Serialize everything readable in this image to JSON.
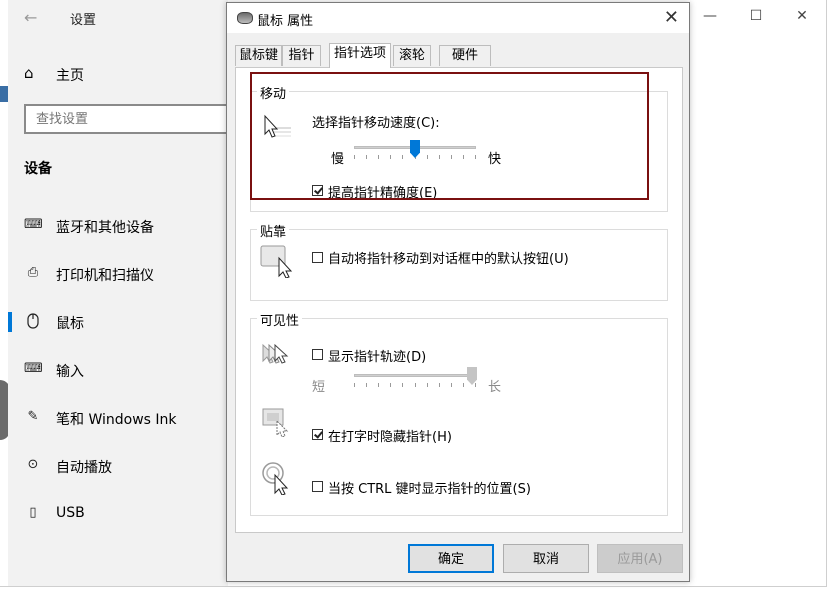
{
  "settings": {
    "title": "设置",
    "home": "主页",
    "search_placeholder": "查找设置",
    "section": "设备",
    "nav": [
      {
        "label": "蓝牙和其他设备"
      },
      {
        "label": "打印机和扫描仪"
      },
      {
        "label": "鼠标"
      },
      {
        "label": "输入"
      },
      {
        "label": "笔和 Windows Ink"
      },
      {
        "label": "自动播放"
      },
      {
        "label": "USB"
      }
    ]
  },
  "dialog": {
    "title": "鼠标 属性",
    "tabs": [
      "鼠标键",
      "指针",
      "指针选项",
      "滚轮",
      "硬件"
    ],
    "active_tab": "指针选项",
    "motion": {
      "legend": "移动",
      "speed_label": "选择指针移动速度(C):",
      "slow": "慢",
      "fast": "快",
      "speed_value": 6,
      "speed_max": 11,
      "enhance_label": "提高指针精确度(E)",
      "enhance_checked": true
    },
    "snap": {
      "legend": "贴靠",
      "snap_label": "自动将指针移动到对话框中的默认按钮(U)",
      "snap_checked": false
    },
    "visibility": {
      "legend": "可见性",
      "trails_label": "显示指针轨迹(D)",
      "trails_checked": false,
      "short": "短",
      "long": "长",
      "hide_label": "在打字时隐藏指针(H)",
      "hide_checked": true,
      "ctrl_label": "当按 CTRL 键时显示指针的位置(S)",
      "ctrl_checked": false
    },
    "buttons": {
      "ok": "确定",
      "cancel": "取消",
      "apply": "应用(A)"
    }
  },
  "colors": {
    "accent": "#0078d7",
    "highlight": "#7a1010"
  }
}
